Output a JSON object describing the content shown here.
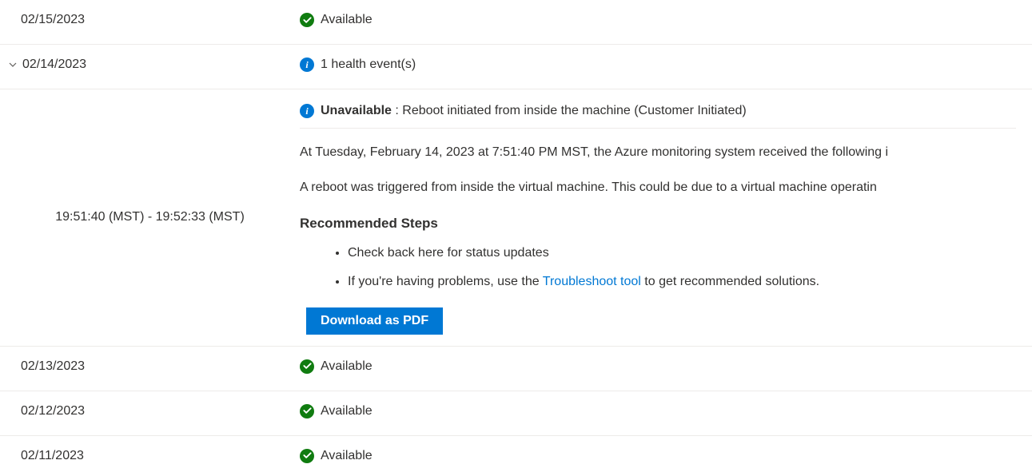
{
  "rows": [
    {
      "date": "02/15/2023",
      "status": "Available",
      "icon": "check"
    },
    {
      "date": "02/14/2023",
      "status": "1 health event(s)",
      "icon": "info",
      "expanded": true
    },
    {
      "date": "02/13/2023",
      "status": "Available",
      "icon": "check"
    },
    {
      "date": "02/12/2023",
      "status": "Available",
      "icon": "check"
    },
    {
      "date": "02/11/2023",
      "status": "Available",
      "icon": "check"
    }
  ],
  "detail": {
    "time_range": "19:51:40 (MST) - 19:52:33 (MST)",
    "status_label": "Unavailable",
    "status_desc": " : Reboot initiated from inside the machine (Customer Initiated)",
    "para1": "At Tuesday, February 14, 2023 at 7:51:40 PM MST, the Azure monitoring system received the following i",
    "para2": "A reboot was triggered from inside the virtual machine. This could be due to a virtual machine operatin",
    "rec_heading": "Recommended Steps",
    "step1": "Check back here for status updates",
    "step2_pre": "If you're having problems, use the ",
    "step2_link": "Troubleshoot tool",
    "step2_post": " to get recommended solutions.",
    "download_label": "Download as PDF"
  }
}
